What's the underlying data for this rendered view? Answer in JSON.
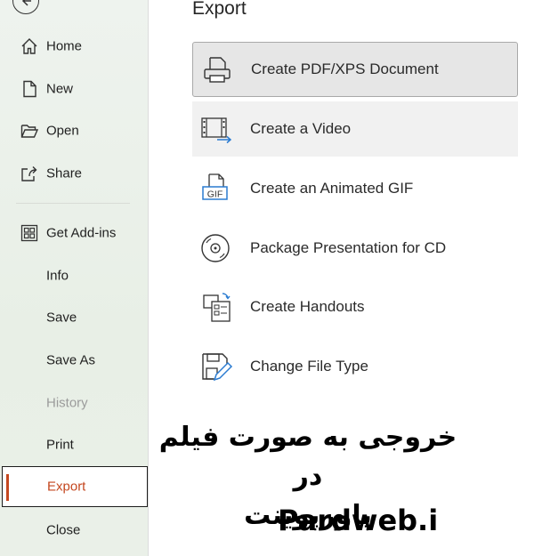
{
  "main": {
    "title": "Export",
    "options": [
      {
        "label": "Create PDF/XPS Document",
        "icon": "pdf-document-icon",
        "state": "selected"
      },
      {
        "label": "Create a Video",
        "icon": "video-icon",
        "state": "hover"
      },
      {
        "label": "Create an Animated GIF",
        "icon": "gif-icon",
        "state": "normal",
        "icon_text": "GIF"
      },
      {
        "label": "Package Presentation for CD",
        "icon": "cd-icon",
        "state": "normal"
      },
      {
        "label": "Create Handouts",
        "icon": "handouts-icon",
        "state": "normal"
      },
      {
        "label": "Change File Type",
        "icon": "change-file-type-icon",
        "state": "normal"
      }
    ]
  },
  "sidebar": {
    "items": [
      {
        "label": "Home",
        "icon": "home-icon"
      },
      {
        "label": "New",
        "icon": "new-document-icon"
      },
      {
        "label": "Open",
        "icon": "folder-open-icon"
      },
      {
        "label": "Share",
        "icon": "share-icon"
      },
      {
        "label": "Get Add-ins",
        "icon": "add-ins-icon"
      },
      {
        "label": "Info"
      },
      {
        "label": "Save"
      },
      {
        "label": "Save As"
      },
      {
        "label": "History",
        "disabled": true
      },
      {
        "label": "Print"
      },
      {
        "label": "Export",
        "active": true
      },
      {
        "label": "Close"
      }
    ]
  },
  "overlay": {
    "persian_line1": "خروجی به صورت فیلم در",
    "persian_line2": "پاورپوینت",
    "site": "Pardweb.i"
  },
  "colors": {
    "accent": "#c4471f",
    "sidebar_bg": "#eaf0e8",
    "selected_bg": "#e6e6e6",
    "icon_blue": "#2a7bd1"
  }
}
